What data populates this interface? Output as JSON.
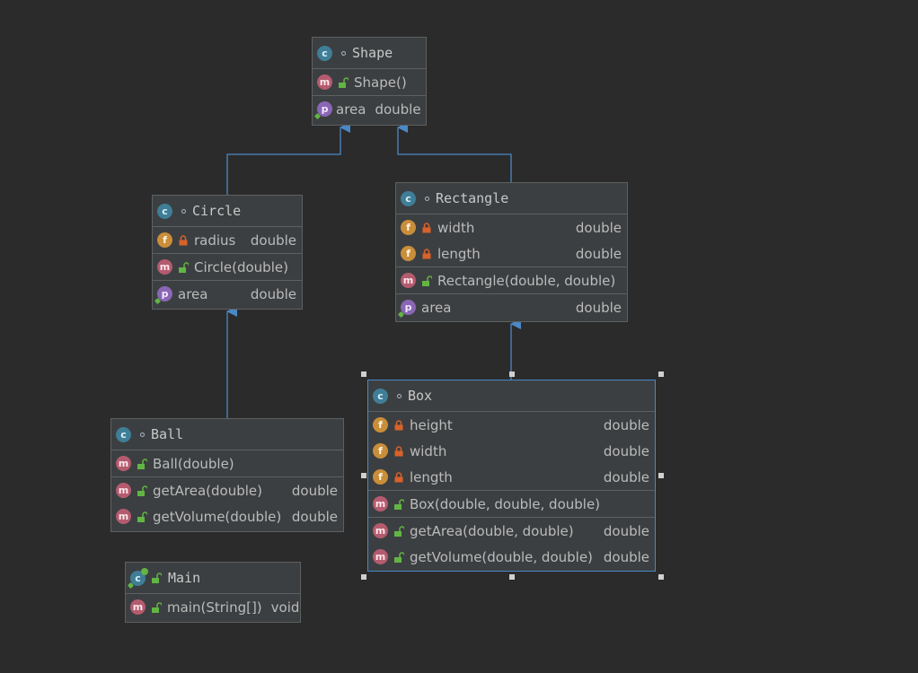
{
  "classes": {
    "shape": {
      "title": "Shape",
      "constructors": [
        {
          "name": "Shape()"
        }
      ],
      "properties": [
        {
          "name": "area",
          "type": "double"
        }
      ]
    },
    "circle": {
      "title": "Circle",
      "fields": [
        {
          "name": "radius",
          "type": "double"
        }
      ],
      "constructors": [
        {
          "name": "Circle(double)"
        }
      ],
      "properties": [
        {
          "name": "area",
          "type": "double"
        }
      ]
    },
    "rectangle": {
      "title": "Rectangle",
      "fields": [
        {
          "name": "width",
          "type": "double"
        },
        {
          "name": "length",
          "type": "double"
        }
      ],
      "constructors": [
        {
          "name": "Rectangle(double, double)"
        }
      ],
      "properties": [
        {
          "name": "area",
          "type": "double"
        }
      ]
    },
    "box": {
      "title": "Box",
      "fields": [
        {
          "name": "height",
          "type": "double"
        },
        {
          "name": "width",
          "type": "double"
        },
        {
          "name": "length",
          "type": "double"
        }
      ],
      "constructors": [
        {
          "name": "Box(double, double, double)"
        }
      ],
      "methods": [
        {
          "name": "getArea(double, double)",
          "type": "double"
        },
        {
          "name": "getVolume(double, double)",
          "type": "double"
        }
      ]
    },
    "ball": {
      "title": "Ball",
      "constructors": [
        {
          "name": "Ball(double)"
        }
      ],
      "methods": [
        {
          "name": "getArea(double)",
          "type": "double"
        },
        {
          "name": "getVolume(double)",
          "type": "double"
        }
      ]
    },
    "main": {
      "title": "Main",
      "methods": [
        {
          "name": "main(String[])",
          "type": "void"
        }
      ]
    }
  },
  "colors": {
    "background": "#2b2b2b",
    "node_fill": "#3c3f41",
    "node_border": "#5e6060",
    "edge": "#4a88c7",
    "selection": "#4a88c7"
  },
  "icons": {
    "class": "class-icon",
    "method": "method-icon",
    "field": "field-icon",
    "property": "property-icon",
    "private": "lock-icon",
    "public": "unlock-icon"
  }
}
